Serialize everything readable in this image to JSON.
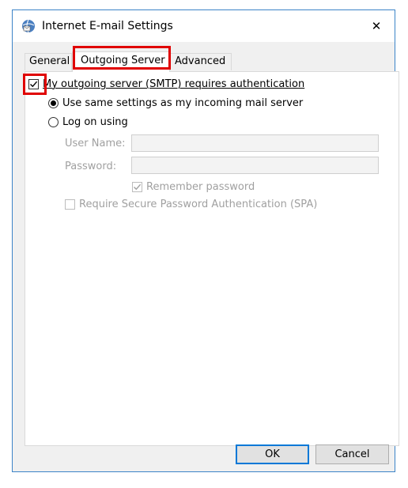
{
  "window": {
    "title": "Internet E-mail Settings",
    "close_glyph": "✕"
  },
  "tabs": [
    {
      "label": "General",
      "selected": false
    },
    {
      "label": "Outgoing Server",
      "selected": true
    },
    {
      "label": "Advanced",
      "selected": false
    }
  ],
  "outgoing": {
    "auth_checkbox_label": "My outgoing server (SMTP) requires authentication",
    "auth_checked": true,
    "radio_same_label": "Use same settings as my incoming mail server",
    "radio_same_selected": true,
    "radio_logon_label": "Log on using",
    "radio_logon_selected": false,
    "username_label": "User Name:",
    "username_value": "",
    "password_label": "Password:",
    "password_value": "",
    "remember_label": "Remember password",
    "remember_checked": true,
    "spa_label": "Require Secure Password Authentication (SPA)",
    "spa_checked": false
  },
  "buttons": {
    "ok": "OK",
    "cancel": "Cancel"
  },
  "colors": {
    "highlight": "#e00000",
    "window_border": "#3c84c8",
    "ok_border": "#0078d7"
  }
}
